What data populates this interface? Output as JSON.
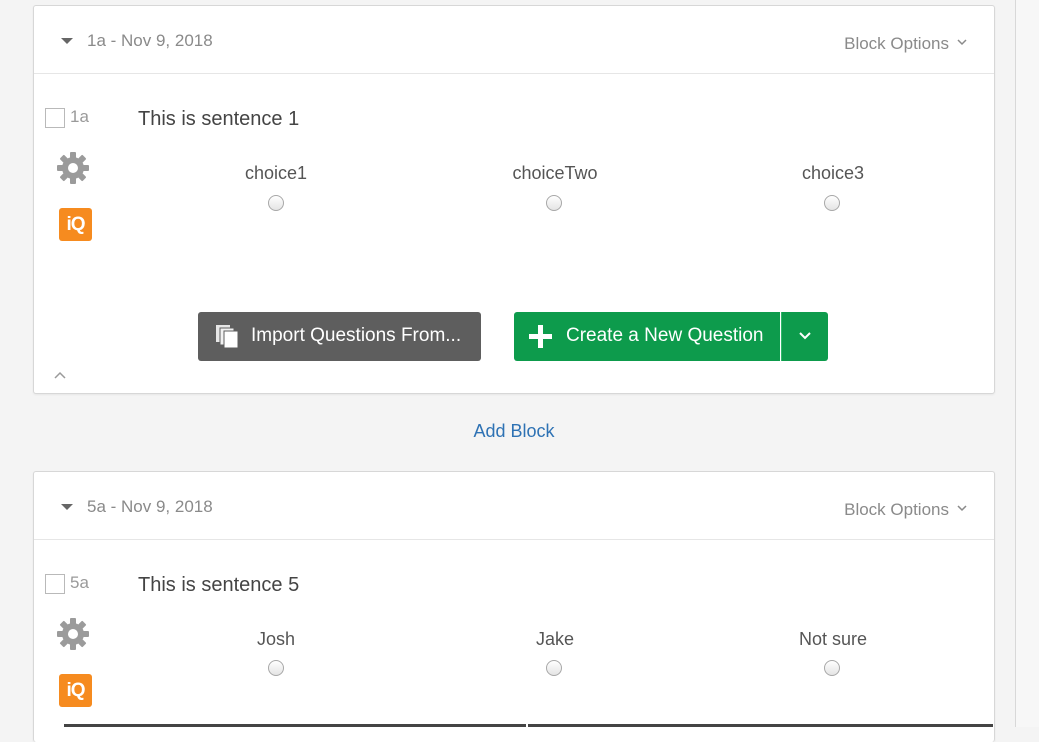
{
  "blocks": [
    {
      "title": "1a - Nov 9, 2018",
      "options_label": "Block Options",
      "question": {
        "number": "1a",
        "text": "This is sentence 1",
        "choices": [
          "choice1",
          "choiceTwo",
          "choice3"
        ]
      },
      "import_button": "Import Questions From...",
      "create_button": "Create a New Question"
    },
    {
      "title": "5a - Nov 9, 2018",
      "options_label": "Block Options",
      "question": {
        "number": "5a",
        "text": "This is sentence 5",
        "choices": [
          "Josh",
          "Jake",
          "Not sure"
        ]
      }
    }
  ],
  "add_block_label": "Add Block",
  "icons": {
    "gear": "gear-icon",
    "iq": "iQ",
    "import": "copy-stack-icon",
    "plus": "plus-icon",
    "chevron": "chevron-down-icon"
  },
  "colors": {
    "create_green": "#0d9b4c",
    "import_gray": "#5e5e5e",
    "iq_orange": "#f68b1f",
    "link_blue": "#2e72b4"
  }
}
